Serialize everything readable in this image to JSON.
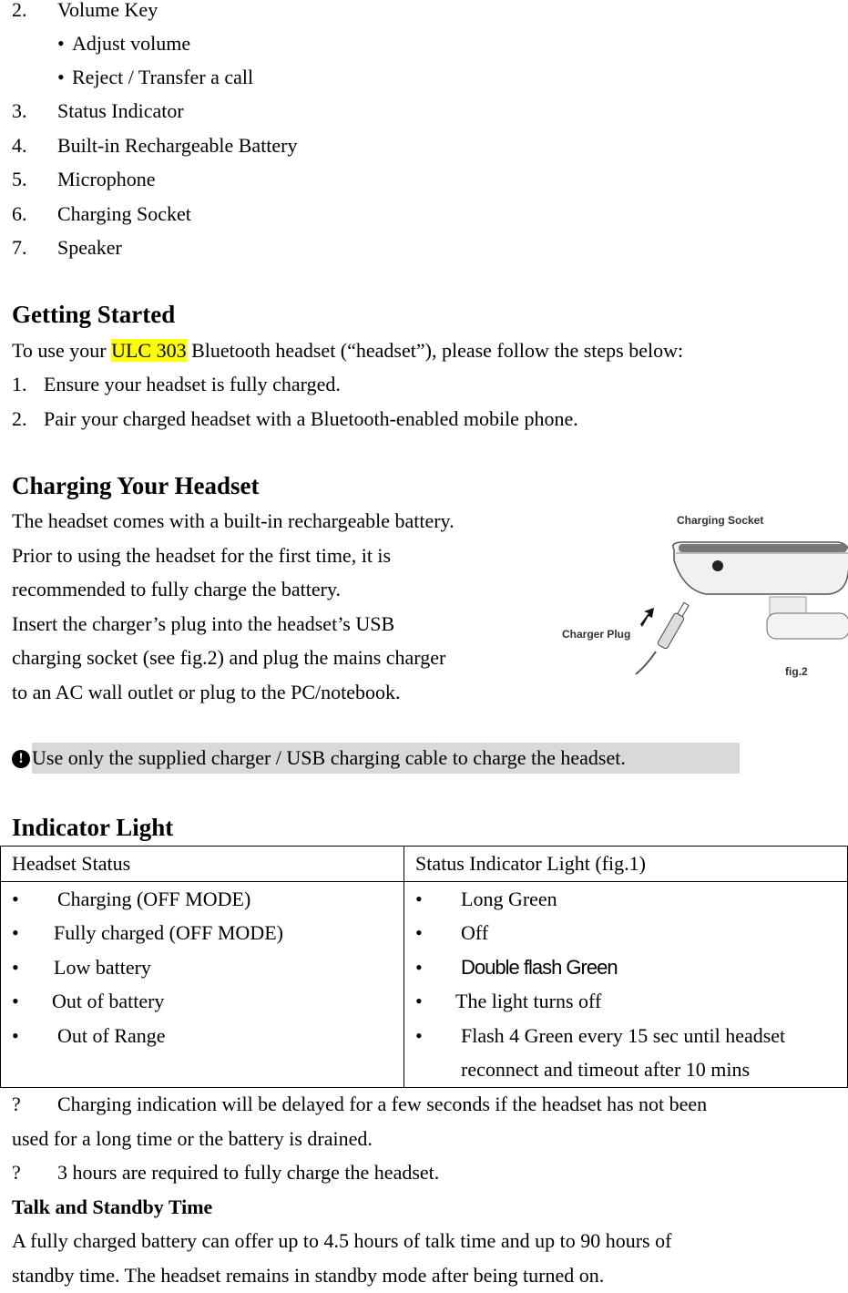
{
  "parts_list": [
    {
      "num": "2.",
      "label": "Volume Key",
      "sub": [
        "Adjust volume",
        "Reject / Transfer a call"
      ]
    },
    {
      "num": "3.",
      "label": "Status Indicator"
    },
    {
      "num": "4.",
      "label": "Built-in Rechargeable Battery"
    },
    {
      "num": "5.",
      "label": "Microphone"
    },
    {
      "num": "6.",
      "label": "Charging Socket"
    },
    {
      "num": "7.",
      "label": "Speaker"
    }
  ],
  "getting_started": {
    "heading": "Getting Started",
    "intro_before": "To use your ",
    "model": "ULC 303",
    "intro_after": " Bluetooth headset (“headset”), please follow the steps below:",
    "steps": [
      {
        "num": "1.",
        "text": "Ensure your headset is fully charged."
      },
      {
        "num": "2.",
        "text": "Pair your charged headset with a Bluetooth-enabled mobile phone."
      }
    ]
  },
  "charging": {
    "heading": "Charging Your Headset",
    "lines": [
      "The headset comes with a built-in rechargeable battery.",
      "Prior to using the headset for the first time, it is",
      "recommended to fully charge the battery.",
      "Insert the charger’s plug into the headset’s USB",
      "charging socket (see fig.2) and plug the mains charger",
      "to an AC wall outlet or plug to the PC/notebook."
    ],
    "figure": {
      "socket_label": "Charging Socket",
      "plug_label": "Charger Plug",
      "caption": "fig.2"
    },
    "note": "Use only the supplied charger / USB charging cable to charge the headset.",
    "note_icon": "exclamation-icon"
  },
  "indicator": {
    "heading": "Indicator Light",
    "headers": [
      "Headset Status",
      "Status Indicator Light (fig.1)"
    ],
    "status": [
      "Charging (OFF MODE)",
      "Fully charged (OFF MODE)",
      "Low battery",
      "Out of battery",
      "Out of Range"
    ],
    "light": [
      "Long Green",
      "Off",
      "Double flash Green",
      "The light turns off",
      "Flash 4 Green every 15 sec until headset reconnect and timeout after 10 mins"
    ],
    "notes": [
      {
        "mark": "?",
        "line1": "Charging indication will be delayed for a few seconds if the headset has not been",
        "line2": "used for a long time or the battery is drained."
      },
      {
        "mark": "?",
        "line1": "3 hours are required to fully charge the headset."
      }
    ]
  },
  "talk_standby": {
    "heading": "Talk and Standby Time",
    "line1": "A fully charged battery can offer up to 4.5 hours of talk time and up to 90 hours of",
    "line2": "standby time. The headset remains in standby mode after being turned on."
  }
}
